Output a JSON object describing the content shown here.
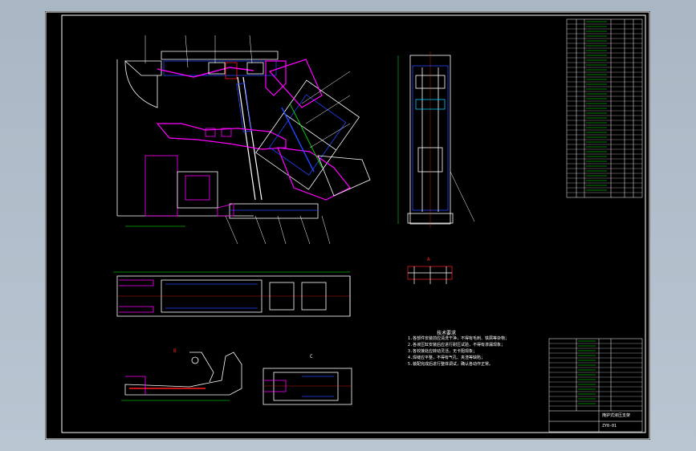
{
  "viewport": {
    "background": "#b3c0cc",
    "sheet_background": "#000000"
  },
  "colors": {
    "frame": "#ffffff",
    "part_white": "#ffffff",
    "part_magenta": "#ff00ff",
    "part_blue": "#2244ff",
    "part_green": "#00ff00",
    "part_cyan": "#00c8ff",
    "part_red": "#ff2020",
    "part_yellow": "#ffff00"
  },
  "drawing": {
    "view_labels": {
      "section_a": "A",
      "section_b": "B",
      "section_c": "C"
    },
    "notes_title": "技术要求",
    "notes": [
      "1.各部件安装前应清洗干净，不得有毛刺、铁屑等杂物；",
      "2.各液压缸安装后应进行耐压试验，不得有渗漏现象；",
      "3.各铰接处应转动灵活，无卡阻现象；",
      "4.焊缝应平整，不得有气孔、夹渣等缺陷；",
      "5.装配完成后进行整体调试，确认各动作正常。"
    ],
    "title_block_name": "掩护式液压支架",
    "drawing_no": "ZY0-01"
  }
}
